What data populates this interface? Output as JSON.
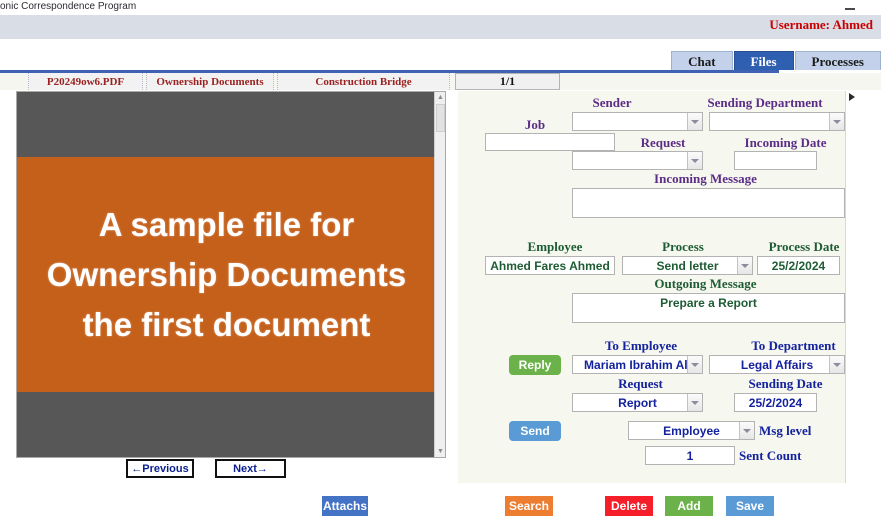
{
  "window": {
    "title": "onic Correspondence Program",
    "minimize_label": "minimize",
    "username": "Username: Ahmed"
  },
  "top_tabs": [
    {
      "label": "Chat",
      "active": false
    },
    {
      "label": "Files",
      "active": true
    },
    {
      "label": "Processes",
      "active": false
    }
  ],
  "doc_tabs": [
    {
      "label": "P20249ow6.PDF"
    },
    {
      "label": "Ownership Documents"
    },
    {
      "label": "Construction Bridge"
    }
  ],
  "page_counter": "1/1",
  "document_preview": {
    "lines": [
      "A sample file for",
      "Ownership Documents",
      "the first document"
    ],
    "slide_color": "#c5601b",
    "canvas_color": "#575757"
  },
  "nav": {
    "previous_label": "←Previous",
    "next_label": "Next→"
  },
  "form": {
    "incoming": {
      "sender_label": "Sender",
      "sender_value": "",
      "sending_department_label": "Sending Department",
      "sending_department_value": "",
      "job_label": "Job",
      "job_value": "",
      "request_label": "Request",
      "request_value": "",
      "incoming_date_label": "Incoming Date",
      "incoming_date_value": "",
      "incoming_message_label": "Incoming Message",
      "incoming_message_value": ""
    },
    "processing": {
      "employee_label": "Employee",
      "employee_value": "Ahmed Fares Ahmed",
      "process_label": "Process",
      "process_value": "Send letter",
      "process_date_label": "Process Date",
      "process_date_value": "25/2/2024",
      "outgoing_message_label": "Outgoing Message",
      "outgoing_message_value": "Prepare a Report"
    },
    "outgoing": {
      "reply_label": "Reply",
      "to_employee_label": "To Employee",
      "to_employee_value": "Mariam Ibrahim Ali",
      "to_department_label": "To Department",
      "to_department_value": "Legal Affairs",
      "request_label": "Request",
      "request_value": "Report",
      "sending_date_label": "Sending Date",
      "sending_date_value": "25/2/2024",
      "send_label": "Send",
      "msg_level_value": "Employee",
      "msg_level_label": "Msg level",
      "sent_count_value": "1",
      "sent_count_label": "Sent Count"
    }
  },
  "actions": {
    "attachs": "Attachs",
    "search": "Search",
    "delete": "Delete",
    "add": "Add",
    "save": "Save"
  },
  "colors": {
    "header_band": "#d8dde6",
    "username": "#cc0000",
    "active_tab": "#2f5fb0",
    "inactive_tab": "#c3d2ea",
    "form_bg": "#f6f7ee",
    "label_purple": "#5b2d87",
    "label_green": "#1e5c34",
    "label_blue": "#14229e",
    "reply": "#6cb24a",
    "send": "#5b9bd5",
    "attachs": "#4472c4",
    "search": "#ed7d31",
    "delete": "#f61e28",
    "add": "#6cb24a",
    "save": "#5b9bd5"
  }
}
